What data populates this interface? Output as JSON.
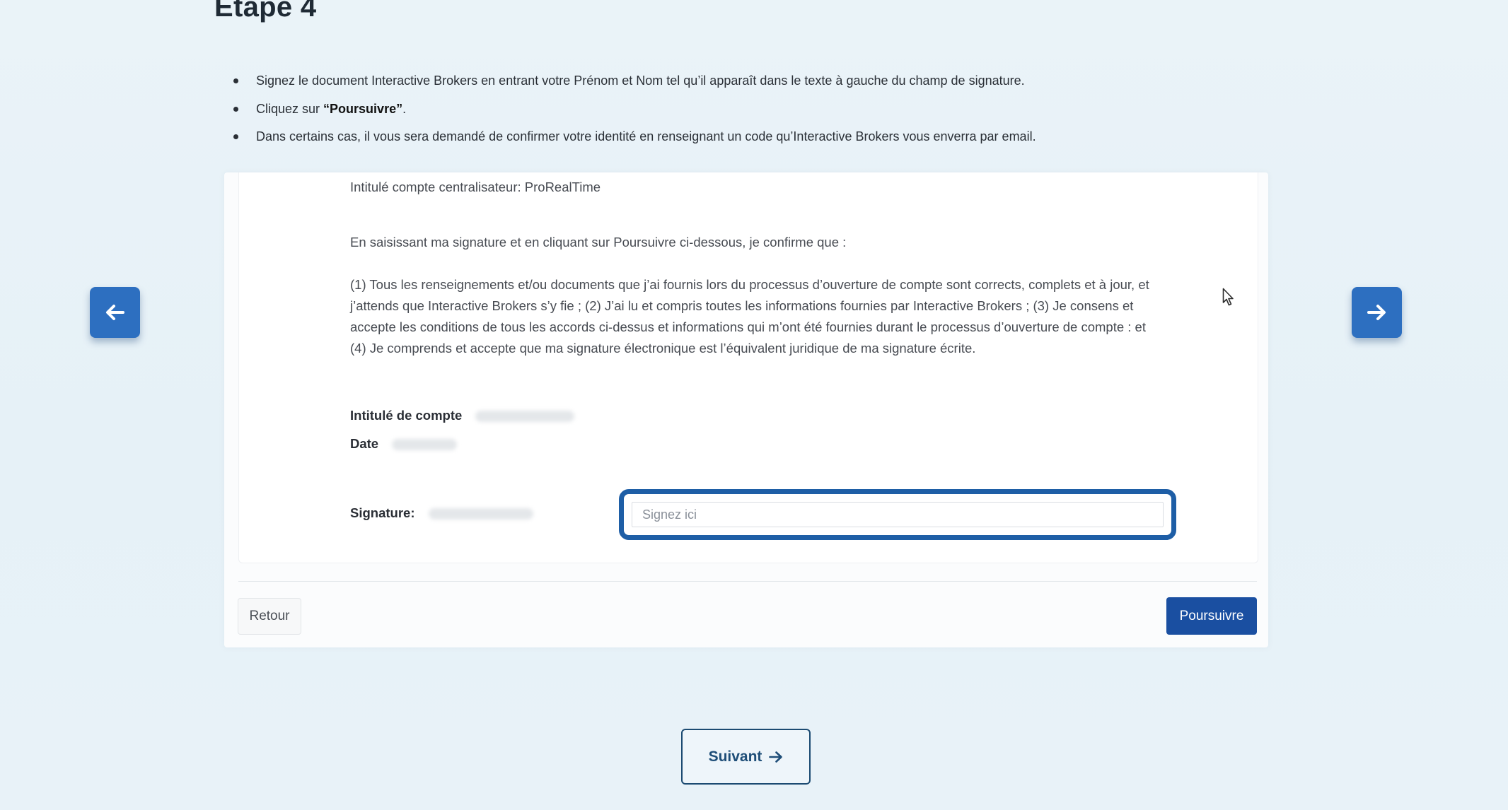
{
  "page": {
    "title": "Etape 4"
  },
  "instructions": {
    "item1": "Signez le document Interactive Brokers en entrant votre Prénom et Nom tel qu’il apparaît dans le texte à gauche du champ de signature.",
    "item2_prefix": "Cliquez sur ",
    "item2_bold": "“Poursuivre”",
    "item2_suffix": ".",
    "item3": "Dans certains cas, il vous sera demandé de confirmer votre identité en renseignant un code qu’Interactive Brokers vous enverra par email."
  },
  "document": {
    "centralisateur": "Intitulé compte centralisateur: ProRealTime",
    "confirm_intro": "En saisissant ma signature et en cliquant sur Poursuivre ci-dessous, je confirme que :",
    "confirm_body": "(1) Tous les renseignements et/ou documents que j’ai fournis lors du processus d’ouverture de compte sont corrects, complets et à jour, et j’attends que Interactive Brokers s’y fie ; (2) J’ai lu et compris toutes les informations fournies par Interactive Brokers ; (3) Je consens et accepte les conditions de tous les accords ci-dessus et informations qui m’ont été fournies durant le processus d’ouverture de compte : et (4) Je comprends et accepte que ma signature électronique est l’équivalent juridique de ma signature écrite.",
    "account_label": "Intitulé de compte",
    "date_label": "Date",
    "signature_label": "Signature:",
    "signature_placeholder": "Signez ici",
    "signature_value": ""
  },
  "buttons": {
    "retour": "Retour",
    "poursuivre": "Poursuivre",
    "suivant": "Suivant"
  },
  "icons": {
    "prev": "arrow-left-icon",
    "next": "arrow-right-icon",
    "suivant": "arrow-right-icon",
    "cursor": "mouse-pointer-icon"
  },
  "colors": {
    "accent": "#1a4fa1",
    "nav_arrow": "#2d6fc0",
    "focus_ring": "#1e5ea6"
  }
}
